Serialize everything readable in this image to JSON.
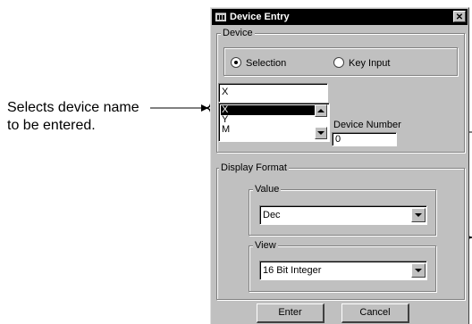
{
  "annotation": {
    "line1": "Selects device name",
    "line2": "to be entered."
  },
  "dialog": {
    "title": "Device Entry",
    "close_glyph": "✕",
    "device_group": {
      "legend": "Device",
      "radio_selection": "Selection",
      "radio_key_input": "Key Input",
      "selected_mode": "Selection"
    },
    "device_name": {
      "value": "X",
      "list": [
        "X",
        "Y",
        "M"
      ],
      "selected_index": 0
    },
    "device_number": {
      "label": "Device Number",
      "value": "0"
    },
    "display_format": {
      "legend": "Display Format",
      "value_group": {
        "legend": "Value",
        "selected": "Dec"
      },
      "view_group": {
        "legend": "View",
        "selected": "16 Bit Integer"
      }
    },
    "buttons": {
      "enter": "Enter",
      "cancel": "Cancel"
    }
  },
  "icons": [
    "device-entry-icon",
    "close-icon",
    "chevron-down-icon",
    "chevron-up-icon",
    "radio-icon"
  ]
}
